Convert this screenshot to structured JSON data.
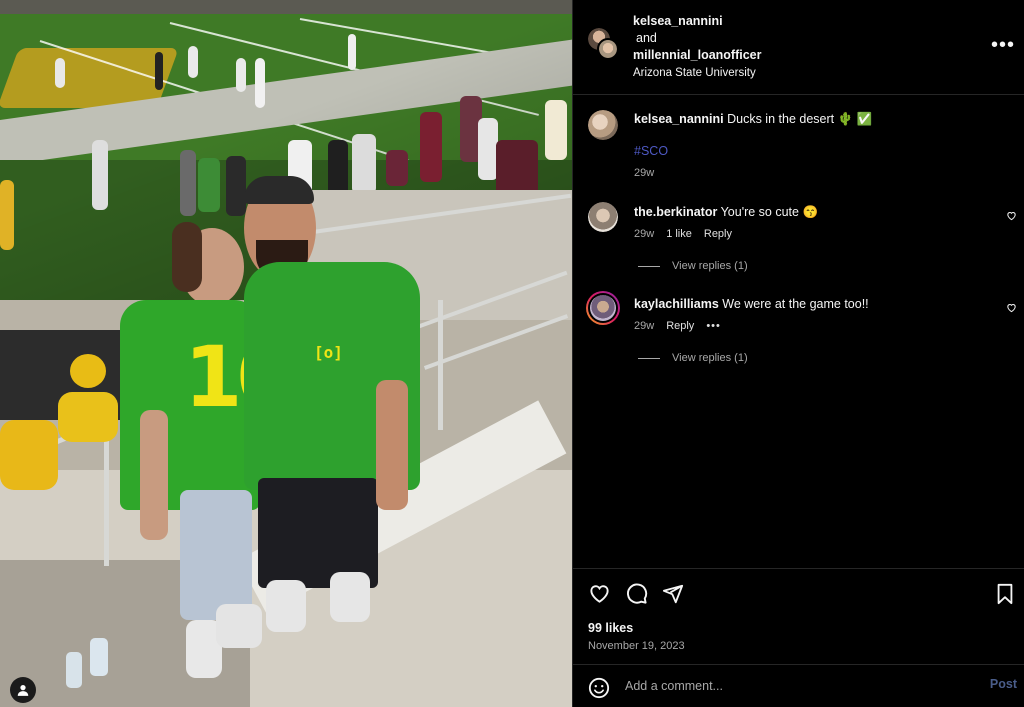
{
  "header": {
    "user1": "kelsea_nannini",
    "joiner": "and",
    "user2": "millennial_loanofficer",
    "location": "Arizona State University",
    "more_icon": "more-horizontal-icon"
  },
  "caption": {
    "username": "kelsea_nannini",
    "text": "Ducks in the desert",
    "emojis": "🌵 ✅",
    "hashtag": "#SCO",
    "time": "29w"
  },
  "comments": [
    {
      "username": "the.berkinator",
      "text": "You're so cute",
      "emoji": "😙",
      "time": "29w",
      "likes": "1 like",
      "reply": "Reply",
      "view_replies": "View replies (1)"
    },
    {
      "username": "kaylachilliams",
      "text": "We were at the game too!!",
      "time": "29w",
      "reply": "Reply",
      "more": "•••",
      "view_replies": "View replies (1)"
    }
  ],
  "actions": {
    "likes": "99 likes",
    "date": "November 19, 2023"
  },
  "comment_box": {
    "placeholder": "Add a comment...",
    "post_label": "Post"
  },
  "photo": {
    "jersey_number": "10",
    "hoodie_logo": "[o]"
  },
  "colors": {
    "hashtag": "#4e59c4",
    "post_disabled": "#4a5d8a",
    "oregon_green": "#2fa72a",
    "oregon_yellow": "#f0e416"
  }
}
